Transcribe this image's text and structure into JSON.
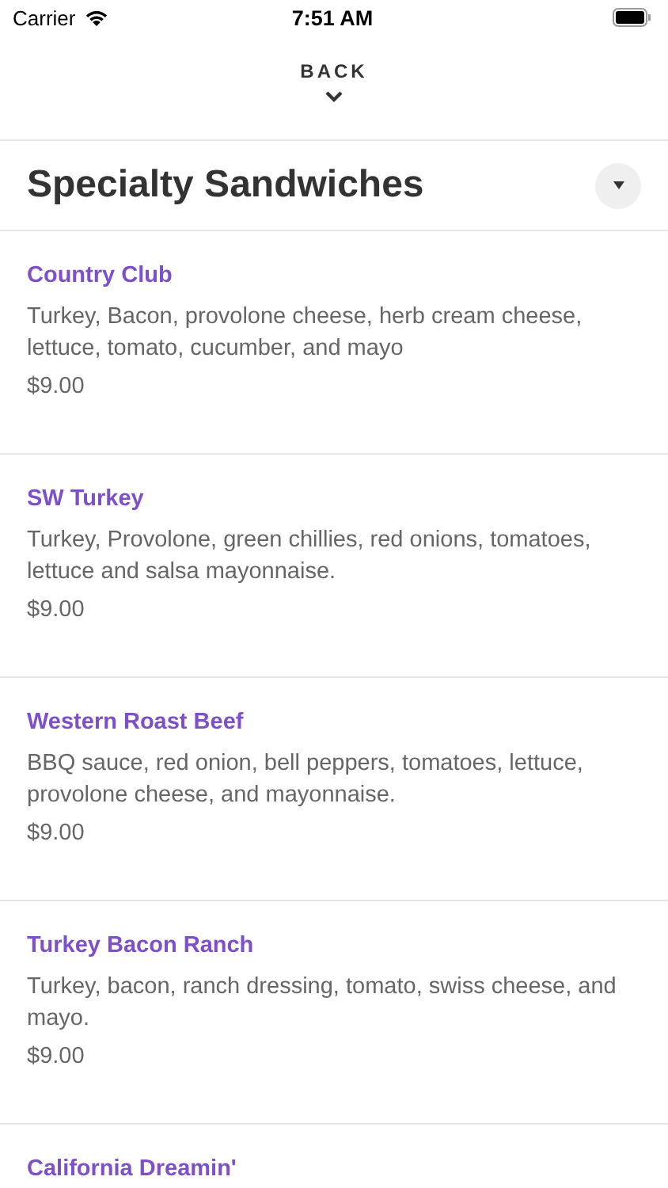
{
  "status_bar": {
    "carrier": "Carrier",
    "time": "7:51 AM"
  },
  "header": {
    "back_label": "BACK"
  },
  "section": {
    "title": "Specialty Sandwiches",
    "expanded": true
  },
  "items": [
    {
      "name": "Country Club",
      "description": "Turkey, Bacon, provolone cheese, herb cream cheese, lettuce, tomato, cucumber, and mayo",
      "price": "$9.00"
    },
    {
      "name": "SW Turkey",
      "description": "Turkey, Provolone, green chillies, red onions, tomatoes, lettuce and salsa mayonnaise.",
      "price": "$9.00"
    },
    {
      "name": "Western Roast Beef",
      "description": "BBQ sauce, red onion, bell peppers, tomatoes, lettuce, provolone cheese, and mayonnaise.",
      "price": "$9.00"
    },
    {
      "name": "Turkey Bacon Ranch",
      "description": "Turkey, bacon, ranch dressing, tomato, swiss cheese, and mayo.",
      "price": "$9.00"
    },
    {
      "name": "California Dreamin'"
    }
  ]
}
